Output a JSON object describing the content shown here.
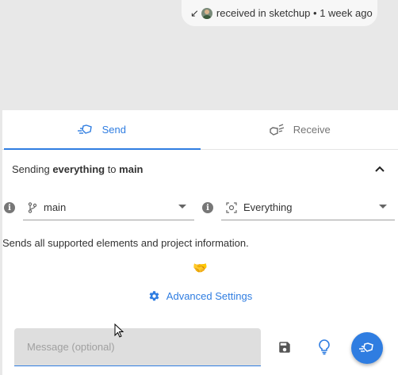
{
  "activity": {
    "arrow": "↙",
    "text": "received in sketchup • 1 week ago"
  },
  "tabs": {
    "send": "Send",
    "receive": "Receive"
  },
  "summary": {
    "prefix": "Sending ",
    "what": "everything",
    "middle": " to ",
    "branch": "main"
  },
  "branch_select": {
    "value": "main",
    "icon": "branch-icon"
  },
  "filter_select": {
    "value": "Everything",
    "icon": "filter-everything-icon"
  },
  "description": "Sends all supported elements and project information.",
  "handshake": "🤝",
  "advanced": {
    "label": "Advanced Settings",
    "icon": "gear-icon"
  },
  "message": {
    "placeholder": "Message (optional)",
    "value": ""
  },
  "colors": {
    "accent": "#2f7de1",
    "background": "#e8e8e8",
    "card": "#ffffff"
  }
}
